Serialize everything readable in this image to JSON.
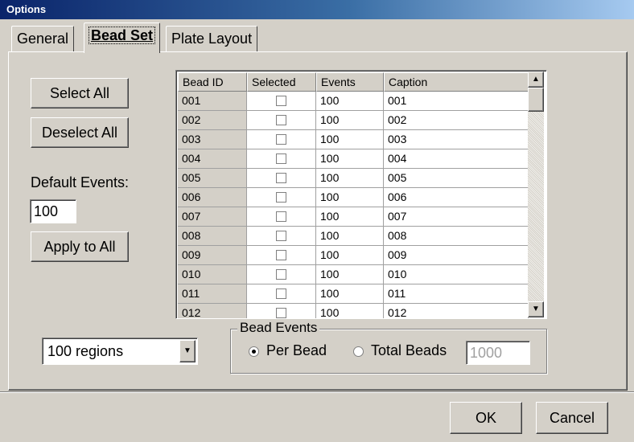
{
  "window": {
    "title": "Options"
  },
  "tabs": [
    {
      "label": "General"
    },
    {
      "label": "Bead Set"
    },
    {
      "label": "Plate Layout"
    }
  ],
  "left": {
    "select_all": "Select All",
    "deselect_all": "Deselect All",
    "default_events_label": "Default Events:",
    "default_events_value": "100",
    "apply_to_all": "Apply to All"
  },
  "grid": {
    "columns": [
      "Bead ID",
      "Selected",
      "Events",
      "Caption"
    ],
    "rows": [
      {
        "id": "001",
        "selected": false,
        "events": "100",
        "caption": "001"
      },
      {
        "id": "002",
        "selected": false,
        "events": "100",
        "caption": "002"
      },
      {
        "id": "003",
        "selected": false,
        "events": "100",
        "caption": "003"
      },
      {
        "id": "004",
        "selected": false,
        "events": "100",
        "caption": "004"
      },
      {
        "id": "005",
        "selected": false,
        "events": "100",
        "caption": "005"
      },
      {
        "id": "006",
        "selected": false,
        "events": "100",
        "caption": "006"
      },
      {
        "id": "007",
        "selected": false,
        "events": "100",
        "caption": "007"
      },
      {
        "id": "008",
        "selected": false,
        "events": "100",
        "caption": "008"
      },
      {
        "id": "009",
        "selected": false,
        "events": "100",
        "caption": "009"
      },
      {
        "id": "010",
        "selected": false,
        "events": "100",
        "caption": "010"
      },
      {
        "id": "011",
        "selected": false,
        "events": "100",
        "caption": "011"
      },
      {
        "id": "012",
        "selected": false,
        "events": "100",
        "caption": "012"
      }
    ]
  },
  "regions": {
    "selected": "100 regions"
  },
  "bead_events": {
    "title": "Bead Events",
    "per_bead": "Per Bead",
    "total_beads": "Total Beads",
    "total_value": "1000",
    "selected_option": "per_bead"
  },
  "footer": {
    "ok": "OK",
    "cancel": "Cancel"
  }
}
